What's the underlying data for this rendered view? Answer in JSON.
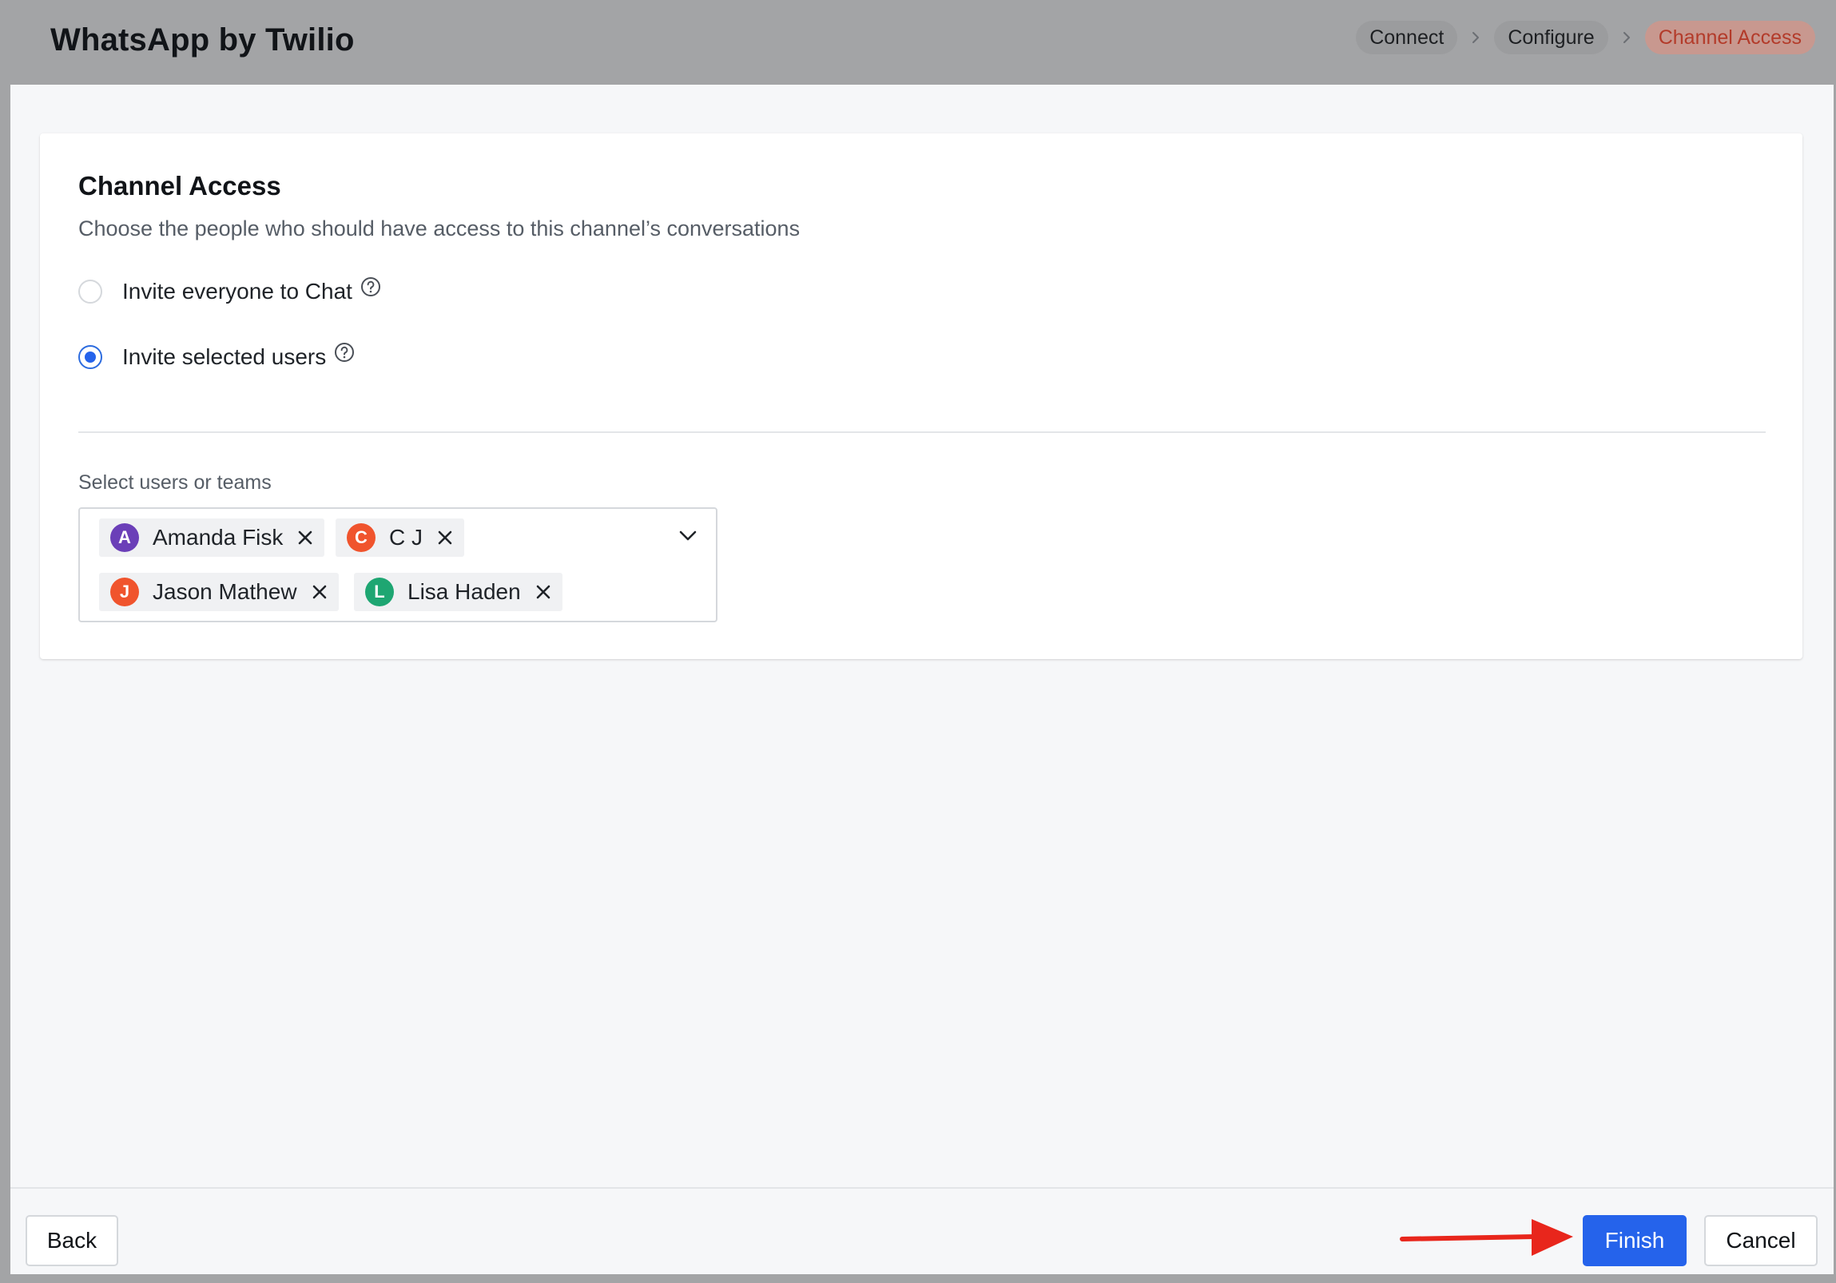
{
  "header": {
    "title": "WhatsApp by Twilio",
    "steps": [
      {
        "label": "Connect",
        "state": "done"
      },
      {
        "label": "Configure",
        "state": "done"
      },
      {
        "label": "Channel Access",
        "state": "active"
      }
    ],
    "step_separator_icon": "chevron-right-icon"
  },
  "card": {
    "title": "Channel Access",
    "subtitle": "Choose the people who should have access to this channel’s conversations",
    "options": [
      {
        "label": "Invite everyone to Chat",
        "checked": false,
        "icon": "help-circle-icon"
      },
      {
        "label": "Invite selected users",
        "checked": true,
        "icon": "help-circle-icon"
      }
    ],
    "select": {
      "label": "Select users or teams",
      "dropdown_icon": "chevron-down-icon",
      "selected": [
        {
          "initial": "A",
          "name": "Amanda Fisk",
          "color": "#6b3fb8"
        },
        {
          "initial": "C",
          "name": "C J",
          "color": "#f0542d"
        },
        {
          "initial": "J",
          "name": "Jason Mathew",
          "color": "#f0542d"
        },
        {
          "initial": "L",
          "name": "Lisa Haden",
          "color": "#1ea672"
        }
      ]
    }
  },
  "footer": {
    "back_label": "Back",
    "finish_label": "Finish",
    "cancel_label": "Cancel",
    "annotation": "red-arrow-pointing-at-finish"
  },
  "colors": {
    "primary": "#2563eb",
    "active_step_text": "#b33b2a",
    "arrow": "#e8261c"
  }
}
